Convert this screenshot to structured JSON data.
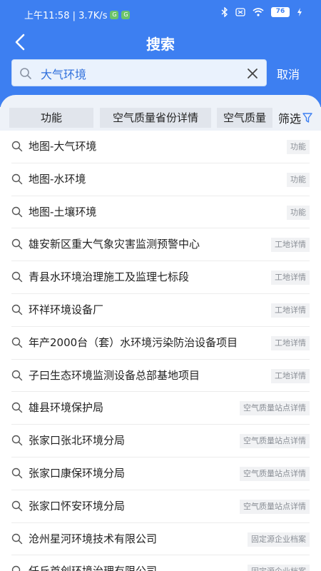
{
  "status_bar": {
    "time_network": "上午11:58 | 3.7K/s",
    "battery": "76"
  },
  "nav": {
    "title": "搜索"
  },
  "search": {
    "value": "大气环境",
    "cancel_label": "取消"
  },
  "filters": {
    "chips": [
      "功能",
      "空气质量省份详情",
      "空气质量"
    ],
    "filter_label": "筛选"
  },
  "results": [
    {
      "text": "地图-大气环境",
      "tag": "功能"
    },
    {
      "text": "地图-水环境",
      "tag": "功能"
    },
    {
      "text": "地图-土壤环境",
      "tag": "功能"
    },
    {
      "text": "雄安新区重大气象灾害监测预警中心",
      "tag": "工地详情"
    },
    {
      "text": "青县水环境治理施工及监理七标段",
      "tag": "工地详情"
    },
    {
      "text": "环祥环境设备厂",
      "tag": "工地详情"
    },
    {
      "text": "年产2000台（套）水环境污染防治设备项目",
      "tag": "工地详情"
    },
    {
      "text": "子曰生态环境监测设备总部基地项目",
      "tag": "工地详情"
    },
    {
      "text": "雄县环境保护局",
      "tag": "空气质量站点详情"
    },
    {
      "text": "张家口张北环境分局",
      "tag": "空气质量站点详情"
    },
    {
      "text": "张家口康保环境分局",
      "tag": "空气质量站点详情"
    },
    {
      "text": "张家口怀安环境分局",
      "tag": "空气质量站点详情"
    },
    {
      "text": "沧州星河环境技术有限公司",
      "tag": "固定源企业档案"
    },
    {
      "text": "任丘首创环境治理有限公司",
      "tag": "固定源企业档案"
    }
  ],
  "colors": {
    "header": "#3d7ff1",
    "search_text": "#2f6fdc",
    "tag_bg": "#f1f2f4"
  },
  "icons": [
    "back-arrow-icon",
    "search-icon",
    "clear-icon",
    "filter-funnel-icon",
    "bluetooth-icon",
    "wifi-icon",
    "battery-icon"
  ]
}
